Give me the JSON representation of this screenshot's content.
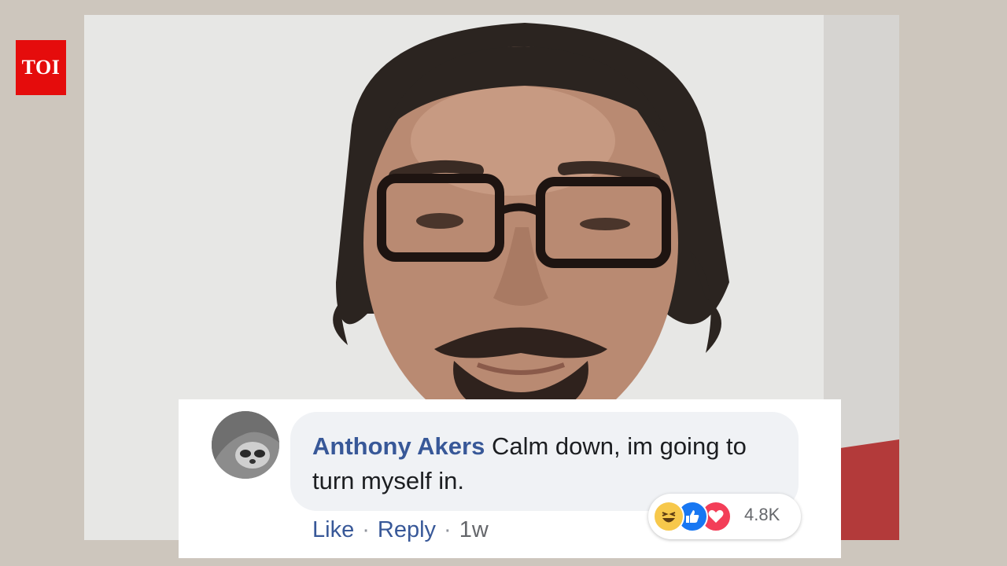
{
  "logo": {
    "text": "TOI",
    "color": "#e50c0c"
  },
  "comment": {
    "author": "Anthony Akers",
    "text": "Calm down, im going to turn myself in.",
    "actions": {
      "like": "Like",
      "reply": "Reply",
      "time": "1w",
      "separator": "·"
    },
    "reactions": {
      "icons": [
        "haha-icon",
        "like-icon",
        "love-icon"
      ],
      "count": "4.8K"
    },
    "author_color": "#385898"
  }
}
